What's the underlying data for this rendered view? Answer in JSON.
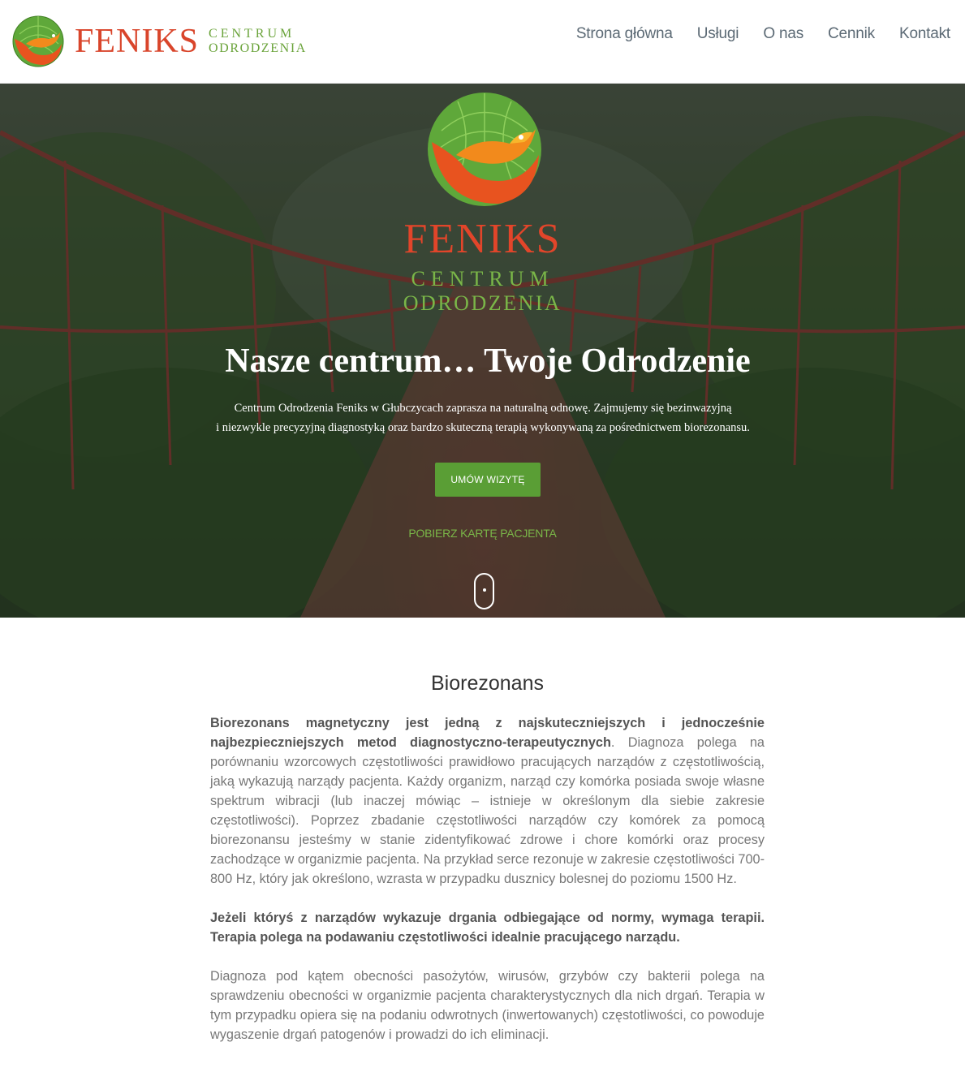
{
  "header": {
    "logo_name": "FENIKS",
    "logo_line1": "CENTRUM",
    "logo_line2": "ODRODZENIA",
    "nav": [
      "Strona główna",
      "Usługi",
      "O nas",
      "Cennik",
      "Kontakt"
    ]
  },
  "hero": {
    "logo_name": "FENIKS",
    "logo_line1": "CENTRUM",
    "logo_line2": "ODRODZENIA",
    "title": "Nasze centrum… Twoje Odrodzenie",
    "text_line1": "Centrum Odrodzenia Feniks w Głubczycach zaprasza na naturalną odnowę. Zajmujemy się bezinwazyjną",
    "text_line2": "i niezwykle precyzyjną diagnostyką oraz bardzo skuteczną terapią wykonywaną za pośrednictwem biorezonansu.",
    "button": "UMÓW WIZYTĘ",
    "link": "POBIERZ KARTĘ PACJENTA"
  },
  "content": {
    "heading": "Biorezonans",
    "p1_bold": "Biorezonans magnetyczny jest jedną z najskuteczniejszych i jednocześnie najbezpieczniejszych metod diagnostyczno-terapeutycznych",
    "p1_rest": ". Diagnoza polega na porównaniu wzorcowych częstotliwości prawidłowo pracujących narządów z częstotliwością, jaką wykazują narządy pacjenta. Każdy organizm, narząd czy komórka posiada swoje własne spektrum wibracji (lub inaczej mówiąc – istnieje w określonym dla siebie zakresie częstotliwości). Poprzez zbadanie częstotliwości narządów czy komórek za pomocą biorezonansu jesteśmy w stanie zidentyfikować zdrowe i chore komórki oraz procesy zachodzące w organizmie pacjenta. Na przykład serce rezonuje w zakresie częstotliwości 700-800 Hz, który jak określono, wzrasta w przypadku dusznicy bolesnej do poziomu 1500 Hz.",
    "p2_bold": "Jeżeli któryś z narządów wykazuje drgania odbiegające od normy, wymaga terapii. Terapia polega na podawaniu częstotliwości idealnie pracującego narządu.",
    "p3": "Diagnoza pod kątem obecności pasożytów, wirusów, grzybów czy bakterii polega na sprawdzeniu obecności w organizmie pacjenta charakterystycznych dla nich drgań. Terapia w tym przypadku opiera się na podaniu odwrotnych (inwertowanych) częstotliwości, co powoduje wygaszenie drgań patogenów i prowadzi do ich eliminacji."
  },
  "colors": {
    "brand_red": "#e2452a",
    "brand_green": "#6aa33a",
    "button_green": "#5a9e35",
    "nav_text": "#5c6a75"
  }
}
